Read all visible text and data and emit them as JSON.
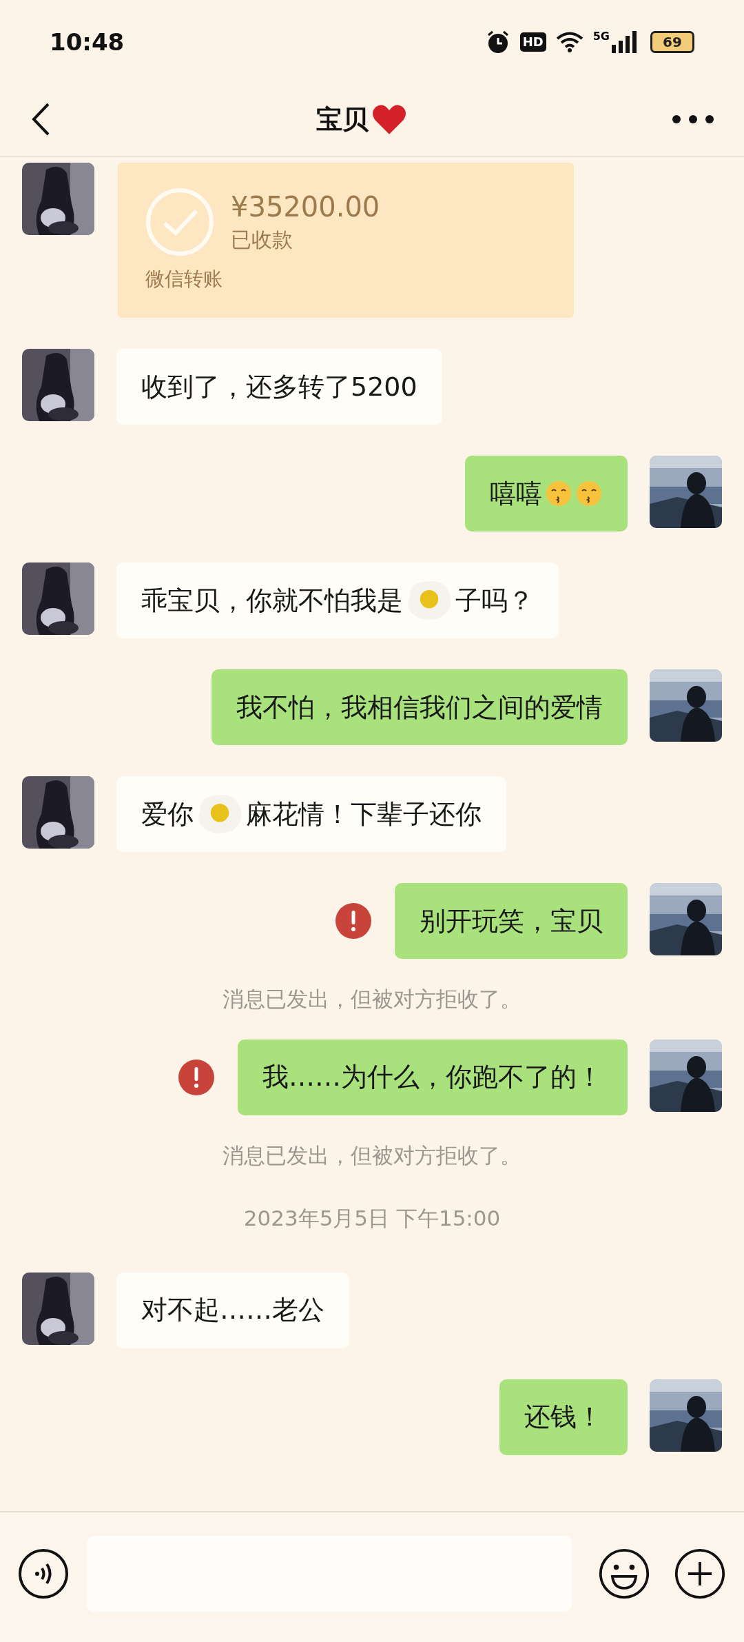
{
  "status_bar": {
    "time": "10:48",
    "hd": "HD",
    "network": "5G",
    "battery": "69"
  },
  "header": {
    "title": "宝贝"
  },
  "messages": [
    {
      "kind": "transfer",
      "outgoing": false,
      "amount": "¥35200.00",
      "status": "已收款",
      "footer": "微信转账"
    },
    {
      "kind": "text",
      "outgoing": false,
      "failed": false,
      "parts": [
        {
          "kind": "text",
          "text": "收到了，还多转了5200"
        }
      ]
    },
    {
      "kind": "text",
      "outgoing": true,
      "failed": false,
      "parts": [
        {
          "kind": "text",
          "text": "嘻嘻"
        },
        {
          "kind": "kiss-emoji"
        },
        {
          "kind": "kiss-emoji"
        }
      ]
    },
    {
      "kind": "text",
      "outgoing": false,
      "failed": false,
      "parts": [
        {
          "kind": "text",
          "text": "乖宝贝，你就不怕我是"
        },
        {
          "kind": "egg-sticker"
        },
        {
          "kind": "text",
          "text": "子吗？"
        }
      ]
    },
    {
      "kind": "text",
      "outgoing": true,
      "failed": false,
      "parts": [
        {
          "kind": "text",
          "text": "我不怕，我相信我们之间的爱情"
        }
      ]
    },
    {
      "kind": "text",
      "outgoing": false,
      "failed": false,
      "parts": [
        {
          "kind": "text",
          "text": "爱你"
        },
        {
          "kind": "egg-sticker"
        },
        {
          "kind": "text",
          "text": "麻花情！下辈子还你"
        }
      ]
    },
    {
      "kind": "text",
      "outgoing": true,
      "failed": true,
      "parts": [
        {
          "kind": "text",
          "text": "别开玩笑，宝贝"
        }
      ]
    },
    {
      "kind": "system",
      "text": "消息已发出，但被对方拒收了。"
    },
    {
      "kind": "text",
      "outgoing": true,
      "failed": true,
      "parts": [
        {
          "kind": "text",
          "text": "我……为什么，你跑不了的！"
        }
      ]
    },
    {
      "kind": "system",
      "text": "消息已发出，但被对方拒收了。"
    },
    {
      "kind": "timestamp",
      "text": "2023年5月5日 下午15:00"
    },
    {
      "kind": "text",
      "outgoing": false,
      "failed": false,
      "parts": [
        {
          "kind": "text",
          "text": "对不起……老公"
        }
      ]
    },
    {
      "kind": "text",
      "outgoing": true,
      "failed": false,
      "parts": [
        {
          "kind": "text",
          "text": "还钱！"
        }
      ]
    }
  ]
}
